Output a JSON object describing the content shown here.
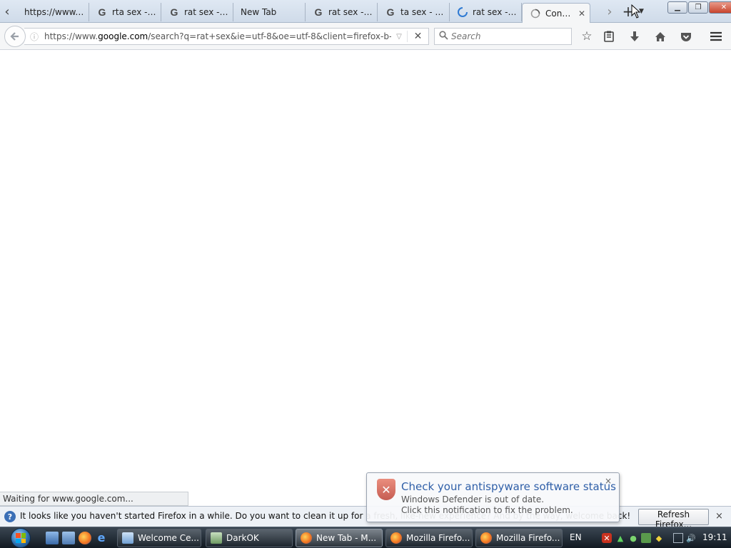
{
  "browser": {
    "tabs": [
      {
        "label": "https://www....",
        "icon": "none"
      },
      {
        "label": "rta sex - ...",
        "icon": "google-icon"
      },
      {
        "label": "rat sex - ...",
        "icon": "google-icon"
      },
      {
        "label": "New Tab",
        "icon": "none"
      },
      {
        "label": "rat sex - ...",
        "icon": "google-icon"
      },
      {
        "label": "ta sex - G...",
        "icon": "google-icon"
      },
      {
        "label": "rat sex - ...",
        "icon": "loading-spinner-icon"
      },
      {
        "label": "Conn...",
        "icon": "loading-icon",
        "selected": true
      }
    ],
    "url": {
      "prefix": "https://www.",
      "host": "google.com",
      "path": "/search?q=rat+sex&ie=utf-8&oe=utf-8&client=firefox-b-ab"
    },
    "search_placeholder": "Search",
    "status_text": "Waiting for www.google.com..."
  },
  "notification": {
    "message": "It looks like you haven't started Firefox in a while. Do you want to clean it up for a fresh, like-new experience? And by the way, welcome back!",
    "button_label": "Refresh Firefox...",
    "close_label": "×"
  },
  "balloon": {
    "title": "Check your antispyware software status",
    "line1": "Windows Defender is out of date.",
    "line2": "Click this notification to fix the problem.",
    "close_label": "×"
  },
  "taskbar": {
    "buttons": [
      {
        "label": "Welcome Ce...",
        "icon": "welcome-center-icon"
      },
      {
        "label": "DarkOK",
        "icon": "window-icon"
      },
      {
        "label": "New Tab - M...",
        "icon": "firefox-icon",
        "active": true
      },
      {
        "label": "Mozilla Firefo...",
        "icon": "firefox-icon"
      },
      {
        "label": "Mozilla Firefo...",
        "icon": "firefox-icon"
      }
    ],
    "language": "EN",
    "clock": "19:11"
  }
}
